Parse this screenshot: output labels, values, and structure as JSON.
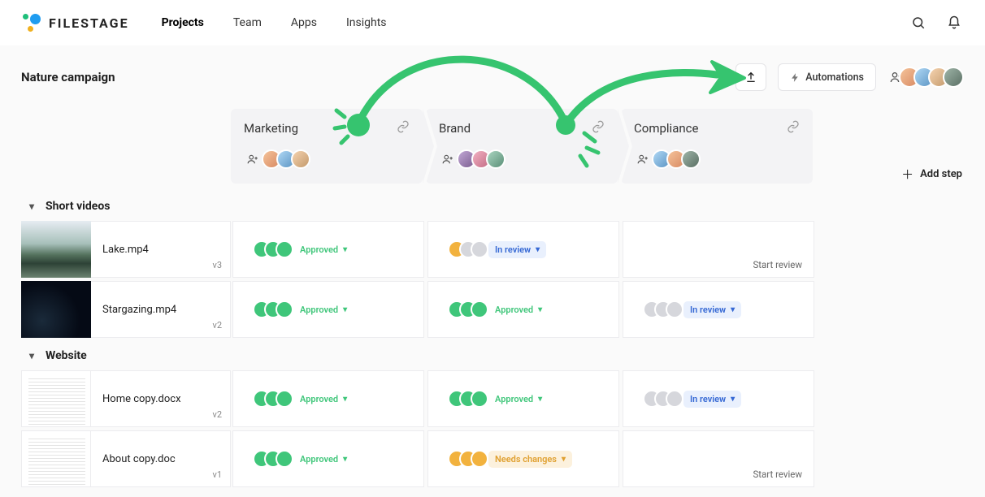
{
  "brand": "FILESTAGE",
  "nav": {
    "projects": "Projects",
    "team": "Team",
    "apps": "Apps",
    "insights": "Insights"
  },
  "project_title": "Nature campaign",
  "automations_label": "Automations",
  "add_step_label": "Add step",
  "steps": [
    {
      "name": "Marketing"
    },
    {
      "name": "Brand"
    },
    {
      "name": "Compliance"
    }
  ],
  "sections": {
    "videos": "Short videos",
    "website": "Website"
  },
  "files": {
    "lake": {
      "name": "Lake.mp4",
      "version": "v3"
    },
    "star": {
      "name": "Stargazing.mp4",
      "version": "v2"
    },
    "homecopy": {
      "name": "Home copy.docx",
      "version": "v2"
    },
    "aboutcopy": {
      "name": "About copy.doc",
      "version": "v1"
    }
  },
  "status": {
    "approved": "Approved",
    "in_review": "In review",
    "needs_changes": "Needs changes",
    "start_review": "Start review"
  }
}
